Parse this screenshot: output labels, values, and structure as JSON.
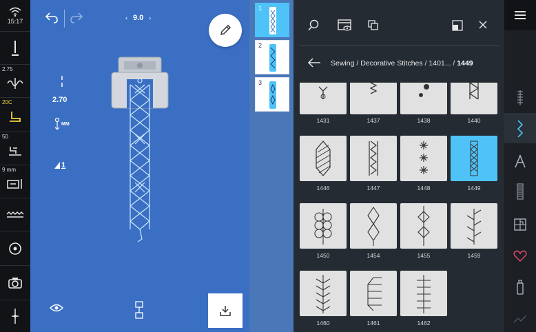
{
  "status_bar": {
    "time": "15:17",
    "stitch_width_badge": "2.75",
    "presser_foot_badge": "20C",
    "stitch_plate_badge": "50",
    "needle_size_badge": "9 mm"
  },
  "editor": {
    "stitch_width_value": "9.0",
    "stitch_length_value": "2.70",
    "stitch_length_unit": "MM",
    "balance_value": "1",
    "colors": {
      "background": "#3a6fc4",
      "stitch": "#cfe9ff",
      "accent": "#4fc3f7"
    }
  },
  "combination": {
    "items": [
      {
        "number": "1",
        "active": true
      },
      {
        "number": "2",
        "active": false
      },
      {
        "number": "3",
        "active": false
      }
    ]
  },
  "panel": {
    "breadcrumb_path": "Sewing / Decorative Stitches / 1401... / ",
    "breadcrumb_current": "1449",
    "stitches": [
      {
        "id": "1431"
      },
      {
        "id": "1437"
      },
      {
        "id": "1438"
      },
      {
        "id": "1440"
      },
      {
        "id": "1446"
      },
      {
        "id": "1447"
      },
      {
        "id": "1448"
      },
      {
        "id": "1449",
        "selected": true
      },
      {
        "id": "1450"
      },
      {
        "id": "1454"
      },
      {
        "id": "1455"
      },
      {
        "id": "1459"
      },
      {
        "id": "1460"
      },
      {
        "id": "1461"
      },
      {
        "id": "1462"
      }
    ]
  },
  "rail": {
    "icons": [
      "menu-icon",
      "stitch-category-icon",
      "decorative-stitch-icon",
      "alphabet-icon",
      "buttonhole-icon",
      "quilt-icon",
      "favorites-icon",
      "spool-icon",
      "more-icon"
    ]
  }
}
